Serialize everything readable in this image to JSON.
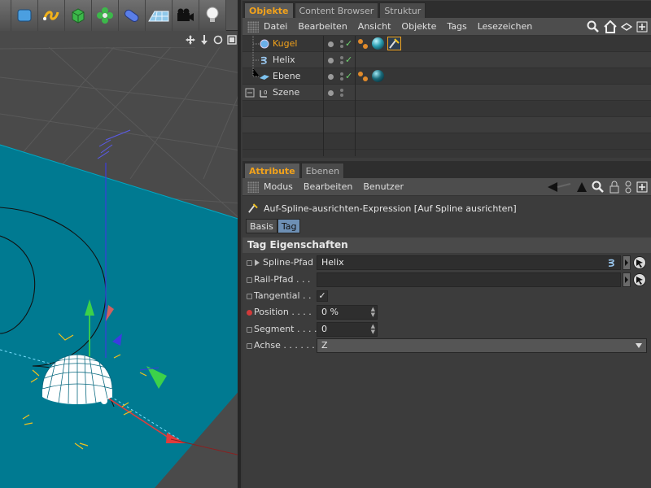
{
  "viewport": {
    "toolbar_icons": [
      "nurbs-icon",
      "spline-pen-icon",
      "cube-icon",
      "deformer-flower-icon",
      "capsule-icon",
      "floor-plane-icon",
      "camera-icon",
      "light-bulb-icon"
    ],
    "header_icons": [
      "move-icon",
      "zoom-icon",
      "rotate-icon",
      "maximize-icon"
    ],
    "floor_color": "#007a91",
    "background_color": "#4a4a4a"
  },
  "object_manager": {
    "tabs": [
      {
        "label": "Objekte",
        "active": true
      },
      {
        "label": "Content Browser",
        "active": false
      },
      {
        "label": "Struktur",
        "active": false
      }
    ],
    "menu": [
      "Datei",
      "Bearbeiten",
      "Ansicht",
      "Objekte",
      "Tags",
      "Lesezeichen"
    ],
    "objects": [
      {
        "name": "Kugel",
        "selected": true,
        "icon": "sphere-icon"
      },
      {
        "name": "Helix",
        "selected": false,
        "icon": "helix-icon"
      },
      {
        "name": "Ebene",
        "selected": false,
        "icon": "plane-icon"
      },
      {
        "name": "Szene",
        "selected": false,
        "icon": "null-object-icon"
      }
    ]
  },
  "attribute_manager": {
    "tabs": [
      {
        "label": "Attribute",
        "active": true
      },
      {
        "label": "Ebenen",
        "active": false
      }
    ],
    "menu": [
      "Modus",
      "Bearbeiten",
      "Benutzer"
    ],
    "title": "Auf-Spline-ausrichten-Expression [Auf Spline ausrichten]",
    "subtabs": [
      {
        "label": "Basis",
        "active": false
      },
      {
        "label": "Tag",
        "active": true
      }
    ],
    "section": "Tag Eigenschaften",
    "properties": {
      "spline_path": {
        "label": "Spline-Pfad",
        "value": "Helix"
      },
      "rail_path": {
        "label": "Rail-Pfad . . .",
        "value": ""
      },
      "tangential": {
        "label": "Tangential . .",
        "checked": "✓"
      },
      "position": {
        "label": "Position . . . .",
        "value": "0 %"
      },
      "segment": {
        "label": "Segment . . . .",
        "value": "0"
      },
      "axis": {
        "label": "Achse . . . . . .",
        "value": "Z"
      }
    }
  },
  "colors": {
    "accent": "#f2a21b",
    "active_subtab": "#6d8fb4",
    "check": "#6fd26f"
  }
}
